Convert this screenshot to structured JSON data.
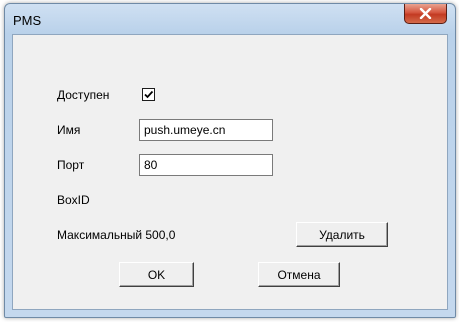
{
  "window": {
    "title": "PMS"
  },
  "form": {
    "enabled_label": "Доступен",
    "enabled_checked": true,
    "name_label": "Имя",
    "name_value": "push.umeye.cn",
    "port_label": "Порт",
    "port_value": "80",
    "boxid_label": "BoxID",
    "max_label": "Максимальный 500,0"
  },
  "buttons": {
    "delete": "Удалить",
    "ok": "OK",
    "cancel": "Отмена"
  },
  "icons": {
    "close": "close-icon",
    "check": "checkmark-icon"
  },
  "colors": {
    "titlebar": "#b9d1ea",
    "close_button": "#c9452c",
    "dialog_background": "#f0f0f0"
  }
}
